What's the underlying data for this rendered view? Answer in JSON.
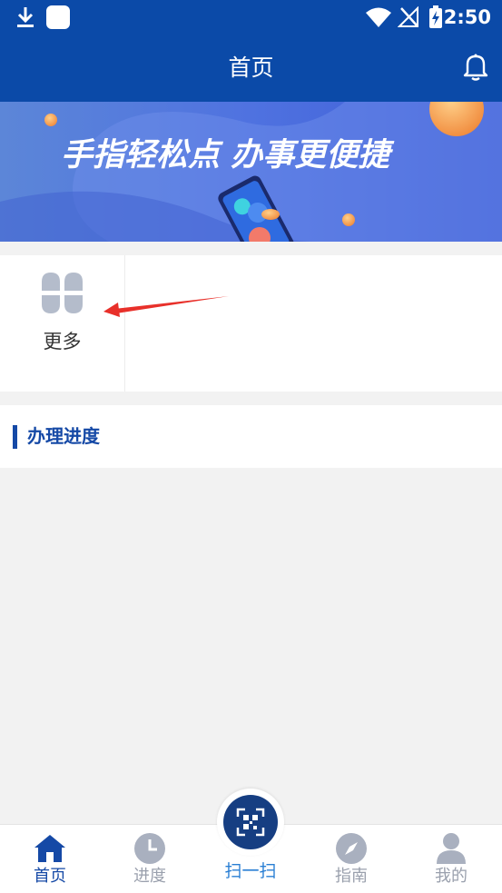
{
  "status_bar": {
    "time": "2:50"
  },
  "header": {
    "title": "首页"
  },
  "banner": {
    "slogan": "手指轻松点 办事更便捷"
  },
  "menu": {
    "more_label": "更多"
  },
  "progress_section": {
    "title": "办理进度"
  },
  "bottom_nav": {
    "items": [
      {
        "label": "首页",
        "icon": "home-icon",
        "active": true
      },
      {
        "label": "进度",
        "icon": "clock-icon",
        "active": false
      },
      {
        "label": "扫一扫",
        "icon": "qr-scan-icon",
        "active": false
      },
      {
        "label": "指南",
        "icon": "compass-icon",
        "active": false
      },
      {
        "label": "我的",
        "icon": "user-icon",
        "active": false
      }
    ]
  },
  "colors": {
    "primary": "#0b4aa8",
    "section_accent": "#1549a6",
    "scan_button": "#163e82",
    "scan_label": "#2a7fd4",
    "inactive_nav": "#9aa0ad",
    "annotation_arrow": "#e8302a"
  }
}
